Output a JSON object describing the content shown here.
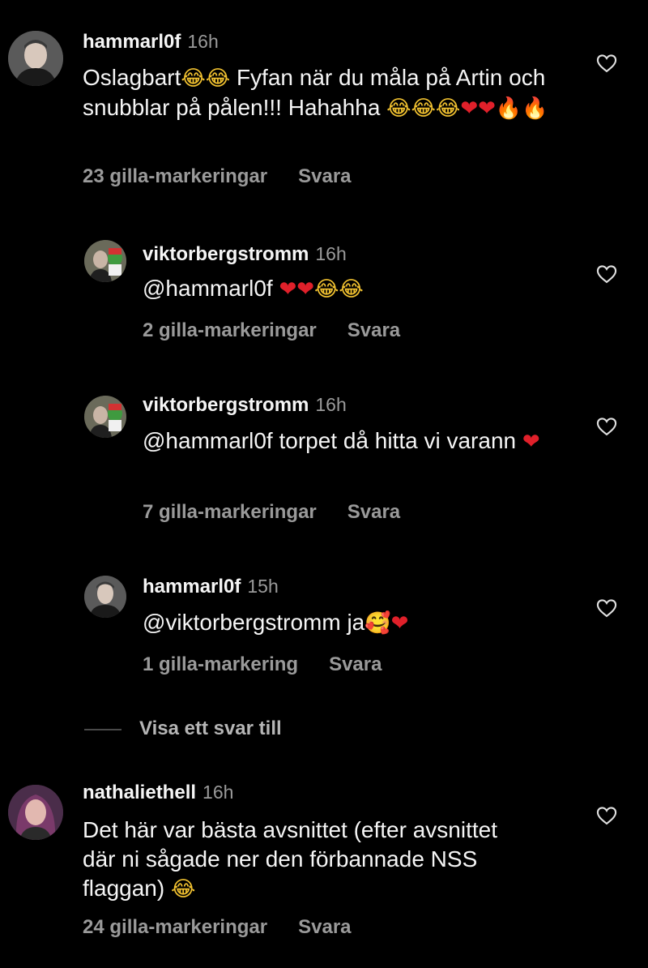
{
  "comments": [
    {
      "username": "hammarl0f",
      "time": "16h",
      "text": "Oslagbart😂😂 Fyfan när du måla på Artin och snubblar på pålen!!! Hahahha 😂😂😂❤️❤️🔥🔥",
      "likes": "23 gilla-markeringar",
      "reply": "Svara"
    },
    {
      "username": "viktorbergstromm",
      "time": "16h",
      "text": "@hammarl0f ❤️❤️😂😂",
      "likes": "2 gilla-markeringar",
      "reply": "Svara"
    },
    {
      "username": "viktorbergstromm",
      "time": "16h",
      "text": "@hammarl0f torpet då hitta vi varann ❤️",
      "likes": "7 gilla-markeringar",
      "reply": "Svara"
    },
    {
      "username": "hammarl0f",
      "time": "15h",
      "text": "@viktorbergstromm ja🥰❤️",
      "likes": "1 gilla-markering",
      "reply": "Svara"
    },
    {
      "username": "nathaliethell",
      "time": "16h",
      "text": "Det här var bästa avsnittet (efter avsnittet där ni sågade ner den förbannade NSS flaggan) 😂",
      "likes": "24 gilla-markeringar",
      "reply": "Svara"
    }
  ],
  "view_more_replies": "Visa ett svar till",
  "icons": {
    "like": "heart-outline-icon"
  },
  "colors": {
    "background": "#000000",
    "text": "#f5f5f5",
    "secondary": "#9a9a9a"
  }
}
